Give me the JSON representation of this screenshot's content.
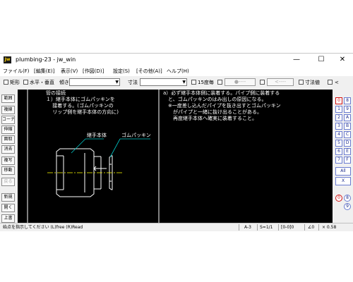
{
  "window": {
    "title": "plumbing-23 - jw_win",
    "icon_text": "Jw",
    "min": "—",
    "max": "☐",
    "close": "✕"
  },
  "menu": [
    "ファイル(F)",
    "[編集(E)]",
    "表示(V)",
    "[作図(D)]",
    "設定(S)",
    "[その他(A)]",
    "ヘルプ(H)"
  ],
  "toolbar": {
    "rect": "矩形",
    "hv": "水平・垂直",
    "tilt": "傾き",
    "dim": "寸法",
    "deg15": "15度毎",
    "dot_btn": "●----",
    "arrow_btn": "<----",
    "dim_value": "寸法値",
    "lt": "<"
  },
  "left_buttons": [
    "範囲",
    "複線",
    "コーナー",
    "伸縮",
    "面取",
    "消去",
    "複写",
    "移動",
    "戻る",
    "新規",
    "開く",
    "上書"
  ],
  "right_buttons": {
    "row1": [
      "0",
      "8"
    ],
    "row2": [
      "1",
      "9"
    ],
    "row3": [
      "2",
      "A"
    ],
    "row4": [
      "3",
      "B"
    ],
    "row5": [
      "4",
      "C"
    ],
    "row6": [
      "5",
      "D"
    ],
    "row7": [
      "6",
      "E"
    ],
    "row8": [
      "7",
      "F"
    ],
    "all": "All",
    "swap": "X",
    "bottom1": [
      "0",
      "8"
    ],
    "bottom2": [
      "9"
    ]
  },
  "drawing": {
    "left_title": "管の接続",
    "left_text_1": "１）継手本体にゴムパッキンを",
    "left_text_2": "　 接着する。(ゴムパッキンの",
    "left_text_3": "　 リップ側を継手本体の方向に)",
    "label_body": "継手本体",
    "label_packing": "ゴムパッキン",
    "right_text_1": "a）必ず継手本体側に装着する。パイプ側に装着する",
    "right_text_2": "　と、ゴムパッキンのはみ出しの原因になる。",
    "right_text_3": "　※一度差し込んだパイプを抜き出すとゴムパッキン",
    "right_text_4": "　　がパイプと一緒に抜け出ることがある。",
    "right_text_5": "　　再度継手本体へ確実に装着すること。"
  },
  "status": {
    "message": "始点を指示してください (L)free (R)Read",
    "paper": "A-3",
    "scale": "S=1/1",
    "layer": "[0-0]0",
    "angle": "∠0",
    "zoom": "× 0.58"
  }
}
